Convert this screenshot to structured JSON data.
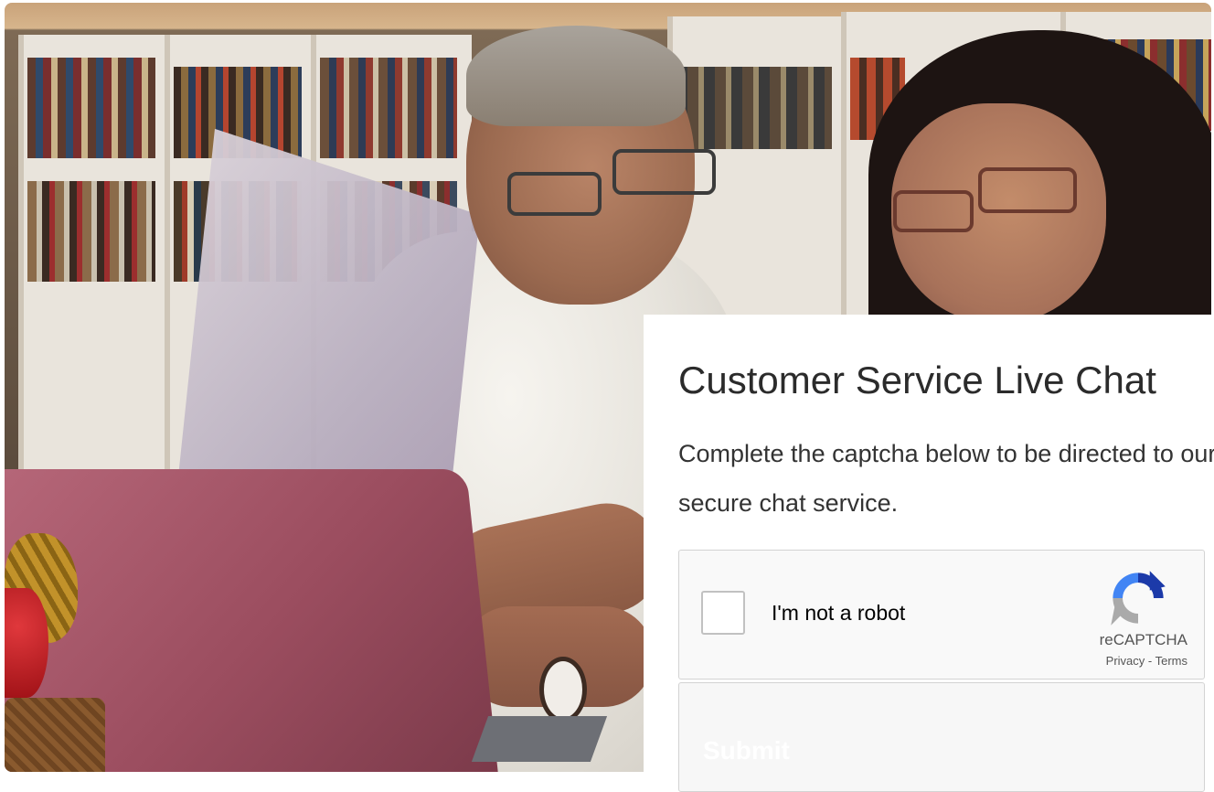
{
  "card": {
    "title": "Customer Service Live Chat",
    "description": "Complete the captcha below to be directed to our secure chat service."
  },
  "recaptcha": {
    "checkbox_label": "I'm not a robot",
    "brand": "reCAPTCHA",
    "privacy": "Privacy",
    "separator": " - ",
    "terms": "Terms",
    "checked": false
  },
  "form": {
    "submit_label": "Submit"
  },
  "image": {
    "alt_subject": "couple-reviewing-documents-photo"
  },
  "colors": {
    "recaptcha_blue": "#1c3aa9",
    "recaptcha_light_blue": "#4285f4",
    "recaptcha_gray": "#aaaaaa"
  }
}
